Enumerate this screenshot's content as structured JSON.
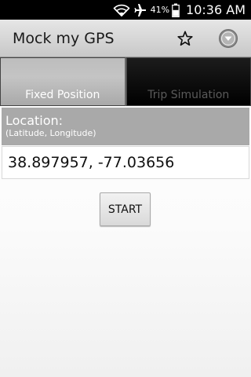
{
  "status_bar": {
    "battery_percent": "41%",
    "time": "10:36 AM",
    "icons": [
      "wifi-icon",
      "airplane-mode-icon",
      "battery-icon"
    ]
  },
  "action_bar": {
    "title": "Mock my GPS",
    "actions": [
      "star-icon",
      "overflow-menu-icon"
    ]
  },
  "tabs": [
    {
      "label": "Fixed Position",
      "active": true
    },
    {
      "label": "Trip Simulation",
      "active": false
    }
  ],
  "location": {
    "title": "Location:",
    "subtitle": "(Latitude, Longitude)",
    "value": "38.897957, -77.03656"
  },
  "start_button": {
    "label": "START"
  }
}
